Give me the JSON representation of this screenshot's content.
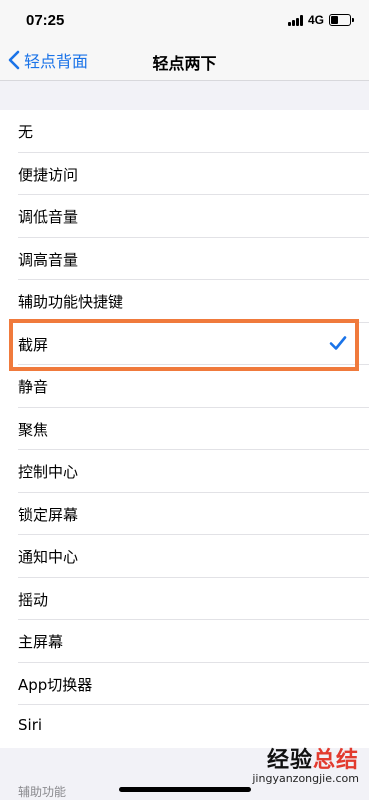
{
  "status_bar": {
    "time": "07:25",
    "network": "4G"
  },
  "nav": {
    "back_label": "轻点背面",
    "title": "轻点两下"
  },
  "options": [
    {
      "label": "无"
    },
    {
      "label": "便捷访问"
    },
    {
      "label": "调低音量"
    },
    {
      "label": "调高音量"
    },
    {
      "label": "辅助功能快捷键"
    },
    {
      "label": "截屏",
      "selected": true
    },
    {
      "label": "静音"
    },
    {
      "label": "聚焦"
    },
    {
      "label": "控制中心"
    },
    {
      "label": "锁定屏幕"
    },
    {
      "label": "通知中心"
    },
    {
      "label": "摇动"
    },
    {
      "label": "主屏幕"
    },
    {
      "label": "App切换器"
    },
    {
      "label": "Siri"
    }
  ],
  "section_footer": "辅助功能",
  "watermark": {
    "text_part1": "经验",
    "text_part2": "总结",
    "url": "jingyanzongjie.com"
  },
  "colors": {
    "accent": "#1a73e8",
    "highlight": "#f07a3c"
  }
}
